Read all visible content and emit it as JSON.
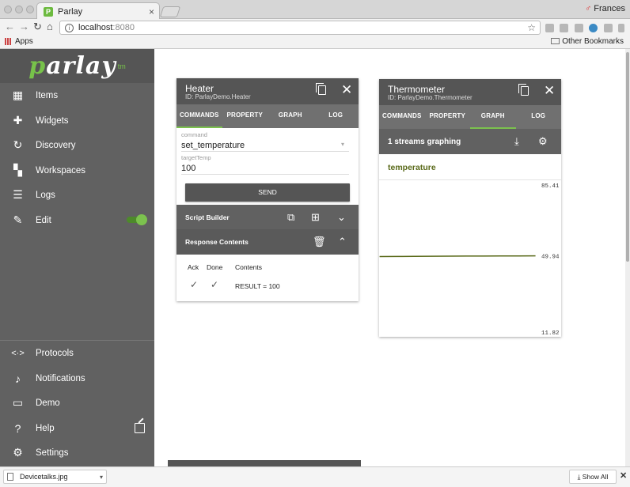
{
  "browser": {
    "tab_title": "Parlay",
    "tab_close": "×",
    "profile_name": "Frances",
    "address_host": "localhost",
    "address_port": ":8080",
    "bookmark_apps": "Apps",
    "bookmark_other": "Other Bookmarks"
  },
  "sidebar": {
    "logo_p": "p",
    "logo_rest": "arlay",
    "logo_tm": "tm",
    "items": [
      {
        "label": "Items",
        "icon": "grid-icon"
      },
      {
        "label": "Widgets",
        "icon": "puzzle-icon"
      },
      {
        "label": "Discovery",
        "icon": "refresh-icon"
      },
      {
        "label": "Workspaces",
        "icon": "dashboard-icon"
      },
      {
        "label": "Logs",
        "icon": "list-icon"
      },
      {
        "label": "Edit",
        "icon": "pencil-icon",
        "toggle_on": true
      },
      {
        "label": "Protocols",
        "icon": "code-arrows-icon"
      },
      {
        "label": "Notifications",
        "icon": "bell-icon"
      },
      {
        "label": "Demo",
        "icon": "laptop-icon"
      },
      {
        "label": "Help",
        "icon": "help-circle-icon"
      },
      {
        "label": "Settings",
        "icon": "gear-icon"
      }
    ]
  },
  "heater": {
    "title": "Heater",
    "id": "ID: ParlayDemo.Heater",
    "tabs": [
      "COMMANDS",
      "PROPERTY",
      "GRAPH",
      "LOG"
    ],
    "active_tab": "COMMANDS",
    "command_label": "command",
    "command_value": "set_temperature",
    "target_label": "targetTemp",
    "target_value": "100",
    "send_label": "SEND",
    "script_builder": "Script Builder",
    "response_contents": "Response Contents",
    "response_headers": [
      "Ack",
      "Done",
      "Contents"
    ],
    "response_rows": [
      {
        "ack": true,
        "done": true,
        "contents": "RESULT = 100"
      }
    ]
  },
  "thermometer": {
    "title": "Thermometer",
    "id": "ID: ParlayDemo.Thermometer",
    "tabs": [
      "COMMANDS",
      "PROPERTY",
      "GRAPH",
      "LOG"
    ],
    "active_tab": "GRAPH",
    "streams_label": "1 streams graphing",
    "stream_name": "temperature",
    "line_color": "#5a6a1a"
  },
  "chart_data": {
    "type": "line",
    "series": [
      {
        "name": "temperature",
        "values": [
          49.6,
          49.65,
          49.7,
          49.75,
          49.8,
          49.84,
          49.88,
          49.9,
          49.92,
          49.94
        ]
      }
    ],
    "ylim": [
      11.82,
      85.41
    ],
    "yticks": [
      "85.41",
      "49.94",
      "11.82"
    ],
    "legend": "temperature",
    "grid": false
  },
  "downloads": {
    "file": "Devicetalks.jpg",
    "show_all": "Show All",
    "close": "✕"
  }
}
